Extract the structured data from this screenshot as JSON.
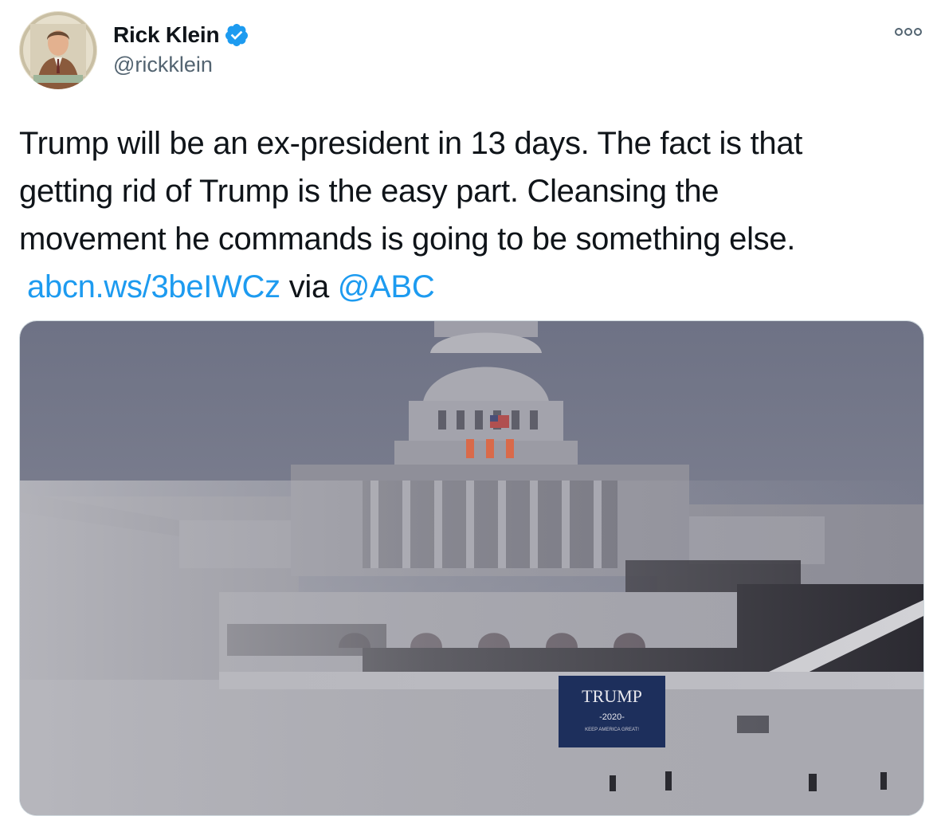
{
  "tweet": {
    "author": {
      "name": "Rick Klein",
      "handle": "@rickklein",
      "verified": true
    },
    "text_lines": [
      "Trump will be an ex-president in 13 days. The fact is that",
      "getting rid of Trump is the easy part. Cleansing the",
      "movement he commands is going to be something else."
    ],
    "link": "abcn.ws/3beIWCz",
    "via": "via",
    "mention": "@ABC",
    "media": {
      "banner_text": "TRUMP",
      "banner_year": "-2020-",
      "banner_slogan": "KEEP AMERICA GREAT!"
    }
  },
  "icons": {
    "verified": "verified-badge-icon",
    "more": "more-options-icon"
  },
  "colors": {
    "link": "#1d9bf0",
    "text": "#0f1419",
    "secondary": "#536471",
    "banner": "#1d2f5c"
  }
}
